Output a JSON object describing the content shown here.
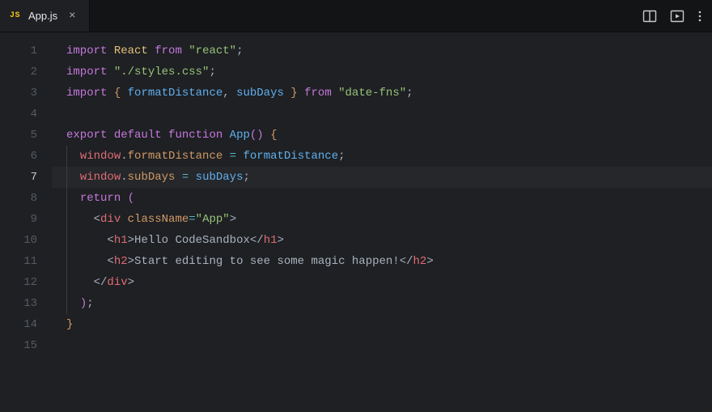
{
  "tab": {
    "icon_label": "JS",
    "filename": "App.js",
    "close_glyph": "×"
  },
  "toolbar_icons": {
    "split": "split-editor-icon",
    "preview": "preview-icon",
    "more": "more-icon"
  },
  "active_line": 7,
  "line_numbers": [
    "1",
    "2",
    "3",
    "4",
    "5",
    "6",
    "7",
    "8",
    "9",
    "10",
    "11",
    "12",
    "13",
    "14",
    "15"
  ],
  "code_lines": [
    {
      "indent": 0,
      "guide": false,
      "tokens": [
        {
          "t": "kw",
          "v": "import"
        },
        {
          "t": "pun",
          "v": " "
        },
        {
          "t": "cls",
          "v": "React"
        },
        {
          "t": "pun",
          "v": " "
        },
        {
          "t": "kw",
          "v": "from"
        },
        {
          "t": "pun",
          "v": " "
        },
        {
          "t": "str",
          "v": "\"react\""
        },
        {
          "t": "pun",
          "v": ";"
        }
      ]
    },
    {
      "indent": 0,
      "guide": false,
      "tokens": [
        {
          "t": "kw",
          "v": "import"
        },
        {
          "t": "pun",
          "v": " "
        },
        {
          "t": "str",
          "v": "\"./styles.css\""
        },
        {
          "t": "pun",
          "v": ";"
        }
      ]
    },
    {
      "indent": 0,
      "guide": false,
      "tokens": [
        {
          "t": "kw",
          "v": "import"
        },
        {
          "t": "pun",
          "v": " "
        },
        {
          "t": "brk",
          "v": "{ "
        },
        {
          "t": "fn",
          "v": "formatDistance"
        },
        {
          "t": "pun",
          "v": ", "
        },
        {
          "t": "fn",
          "v": "subDays"
        },
        {
          "t": "brk",
          "v": " }"
        },
        {
          "t": "pun",
          "v": " "
        },
        {
          "t": "kw",
          "v": "from"
        },
        {
          "t": "pun",
          "v": " "
        },
        {
          "t": "str",
          "v": "\"date-fns\""
        },
        {
          "t": "pun",
          "v": ";"
        }
      ]
    },
    {
      "indent": 0,
      "guide": false,
      "tokens": []
    },
    {
      "indent": 0,
      "guide": false,
      "tokens": [
        {
          "t": "kw",
          "v": "export"
        },
        {
          "t": "pun",
          "v": " "
        },
        {
          "t": "kw",
          "v": "default"
        },
        {
          "t": "pun",
          "v": " "
        },
        {
          "t": "kw",
          "v": "function"
        },
        {
          "t": "pun",
          "v": " "
        },
        {
          "t": "fn",
          "v": "App"
        },
        {
          "t": "par",
          "v": "()"
        },
        {
          "t": "pun",
          "v": " "
        },
        {
          "t": "brk",
          "v": "{"
        }
      ]
    },
    {
      "indent": 1,
      "guide": true,
      "tokens": [
        {
          "t": "id",
          "v": "window"
        },
        {
          "t": "pun",
          "v": "."
        },
        {
          "t": "prop",
          "v": "formatDistance"
        },
        {
          "t": "pun",
          "v": " "
        },
        {
          "t": "op",
          "v": "="
        },
        {
          "t": "pun",
          "v": " "
        },
        {
          "t": "fn",
          "v": "formatDistance"
        },
        {
          "t": "pun",
          "v": ";"
        }
      ]
    },
    {
      "indent": 1,
      "guide": true,
      "tokens": [
        {
          "t": "id",
          "v": "window"
        },
        {
          "t": "pun",
          "v": "."
        },
        {
          "t": "prop",
          "v": "subDays"
        },
        {
          "t": "pun",
          "v": " "
        },
        {
          "t": "op",
          "v": "="
        },
        {
          "t": "pun",
          "v": " "
        },
        {
          "t": "fn",
          "v": "subDays"
        },
        {
          "t": "pun",
          "v": ";"
        }
      ]
    },
    {
      "indent": 1,
      "guide": true,
      "tokens": [
        {
          "t": "kw",
          "v": "return"
        },
        {
          "t": "pun",
          "v": " "
        },
        {
          "t": "par",
          "v": "("
        }
      ]
    },
    {
      "indent": 2,
      "guide": true,
      "tokens": [
        {
          "t": "tag",
          "v": "<"
        },
        {
          "t": "id",
          "v": "div"
        },
        {
          "t": "pun",
          "v": " "
        },
        {
          "t": "prop",
          "v": "className"
        },
        {
          "t": "op",
          "v": "="
        },
        {
          "t": "str",
          "v": "\"App\""
        },
        {
          "t": "tag",
          "v": ">"
        }
      ]
    },
    {
      "indent": 3,
      "guide": true,
      "tokens": [
        {
          "t": "tag",
          "v": "<"
        },
        {
          "t": "id",
          "v": "h1"
        },
        {
          "t": "tag",
          "v": ">"
        },
        {
          "t": "txt",
          "v": "Hello CodeSandbox"
        },
        {
          "t": "tag",
          "v": "</"
        },
        {
          "t": "id",
          "v": "h1"
        },
        {
          "t": "tag",
          "v": ">"
        }
      ]
    },
    {
      "indent": 3,
      "guide": true,
      "tokens": [
        {
          "t": "tag",
          "v": "<"
        },
        {
          "t": "id",
          "v": "h2"
        },
        {
          "t": "tag",
          "v": ">"
        },
        {
          "t": "txt",
          "v": "Start editing to see some magic happen!"
        },
        {
          "t": "tag",
          "v": "</"
        },
        {
          "t": "id",
          "v": "h2"
        },
        {
          "t": "tag",
          "v": ">"
        }
      ]
    },
    {
      "indent": 2,
      "guide": true,
      "tokens": [
        {
          "t": "tag",
          "v": "</"
        },
        {
          "t": "id",
          "v": "div"
        },
        {
          "t": "tag",
          "v": ">"
        }
      ]
    },
    {
      "indent": 1,
      "guide": true,
      "tokens": [
        {
          "t": "par",
          "v": ")"
        },
        {
          "t": "pun",
          "v": ";"
        }
      ]
    },
    {
      "indent": 0,
      "guide": false,
      "tokens": [
        {
          "t": "brk",
          "v": "}"
        }
      ]
    },
    {
      "indent": 0,
      "guide": false,
      "tokens": []
    }
  ]
}
